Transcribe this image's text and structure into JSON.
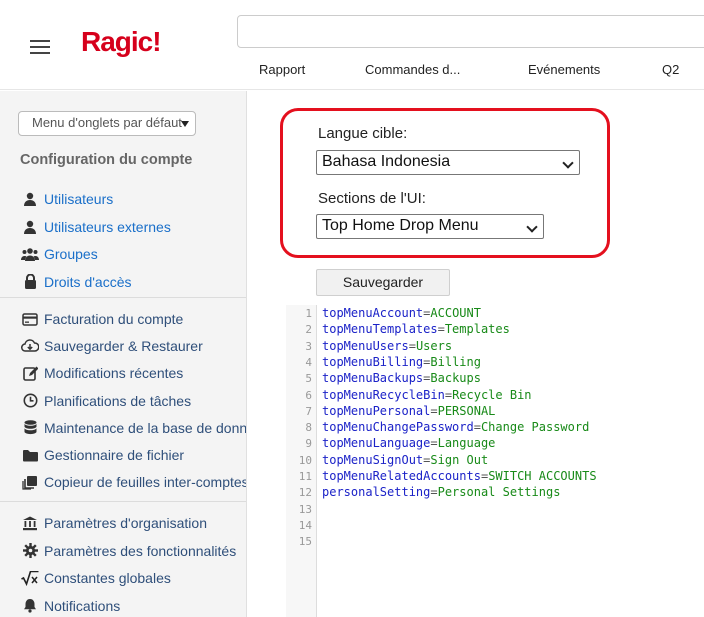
{
  "header": {
    "logo": "Ragic!",
    "tabs": [
      "Rapport",
      "Commandes d...",
      "Evénements",
      "Q2"
    ]
  },
  "sidebar": {
    "tab_select_label": "Menu d'onglets par défaut",
    "section_title": "Configuration du compte",
    "group1": [
      {
        "label": "Utilisateurs",
        "icon": "user-icon"
      },
      {
        "label": "Utilisateurs externes",
        "icon": "user-icon"
      },
      {
        "label": "Groupes",
        "icon": "users-group-icon"
      },
      {
        "label": "Droits d'accès",
        "icon": "lock-icon"
      }
    ],
    "group2": [
      {
        "label": "Facturation du compte",
        "icon": "credit-card-icon"
      },
      {
        "label": "Sauvegarder & Restaurer",
        "icon": "cloud-download-icon"
      },
      {
        "label": "Modifications récentes",
        "icon": "edit-icon"
      },
      {
        "label": "Planifications de tâches",
        "icon": "clock-icon"
      },
      {
        "label": "Maintenance de la base de données",
        "icon": "database-icon"
      },
      {
        "label": "Gestionnaire de fichier",
        "icon": "folder-icon"
      },
      {
        "label": "Copieur de feuilles inter-comptes",
        "icon": "copy-icon"
      }
    ],
    "group3": [
      {
        "label": "Paramètres d'organisation",
        "icon": "institution-icon"
      },
      {
        "label": "Paramètres des fonctionnalités",
        "icon": "gear-icon"
      },
      {
        "label": "Constantes globales",
        "icon": "sqrt-x-icon"
      },
      {
        "label": "Notifications",
        "icon": "bell-icon"
      }
    ]
  },
  "main": {
    "target_language_label": "Langue cible:",
    "target_language_value": "Bahasa Indonesia",
    "ui_sections_label": "Sections de l'UI:",
    "ui_sections_value": "Top Home Drop Menu",
    "save_label": "Sauvegarder",
    "editor_lines": [
      {
        "num": "1",
        "key": "topMenuAccount",
        "value": "ACCOUNT"
      },
      {
        "num": "2",
        "key": "topMenuTemplates",
        "value": "Templates"
      },
      {
        "num": "3",
        "key": "topMenuUsers",
        "value": "Users"
      },
      {
        "num": "4",
        "key": "topMenuBilling",
        "value": "Billing"
      },
      {
        "num": "5",
        "key": "topMenuBackups",
        "value": "Backups"
      },
      {
        "num": "6",
        "key": "topMenuRecycleBin",
        "value": "Recycle Bin"
      },
      {
        "num": "7",
        "key": "topMenuPersonal",
        "value": "PERSONAL"
      },
      {
        "num": "8",
        "key": "topMenuChangePassword",
        "value": "Change Password"
      },
      {
        "num": "9",
        "key": "topMenuLanguage",
        "value": "Language"
      },
      {
        "num": "10",
        "key": "topMenuSignOut",
        "value": "Sign Out"
      },
      {
        "num": "11",
        "key": "topMenuRelatedAccounts",
        "value": "SWITCH ACCOUNTS"
      },
      {
        "num": "12",
        "key": "personalSetting",
        "value": "Personal Settings"
      },
      {
        "num": "13",
        "key": "",
        "value": ""
      },
      {
        "num": "14",
        "key": "",
        "value": ""
      },
      {
        "num": "15",
        "key": "",
        "value": ""
      }
    ]
  },
  "colors": {
    "brand": "#d6001c",
    "link": "#1a6fc9",
    "highlight": "#e4101e",
    "code_key": "#1b22c8",
    "code_value": "#188a18"
  }
}
